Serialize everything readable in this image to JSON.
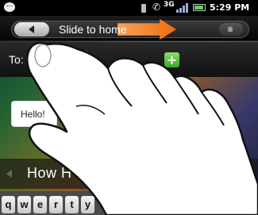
{
  "status_bar": {
    "time": "5:29 PM",
    "network": "3G"
  },
  "slide_bar": {
    "label": "Slide to home"
  },
  "to_row": {
    "label": "To:"
  },
  "message": {
    "text": "Hello!"
  },
  "compose": {
    "text": "How H"
  },
  "keyboard": {
    "keys": [
      "q",
      "w",
      "e",
      "r",
      "t",
      "y"
    ]
  },
  "colors": {
    "slide_arrow": "#f06c10",
    "to_field": "#6aa2d4",
    "add_button": "#3aa528"
  }
}
